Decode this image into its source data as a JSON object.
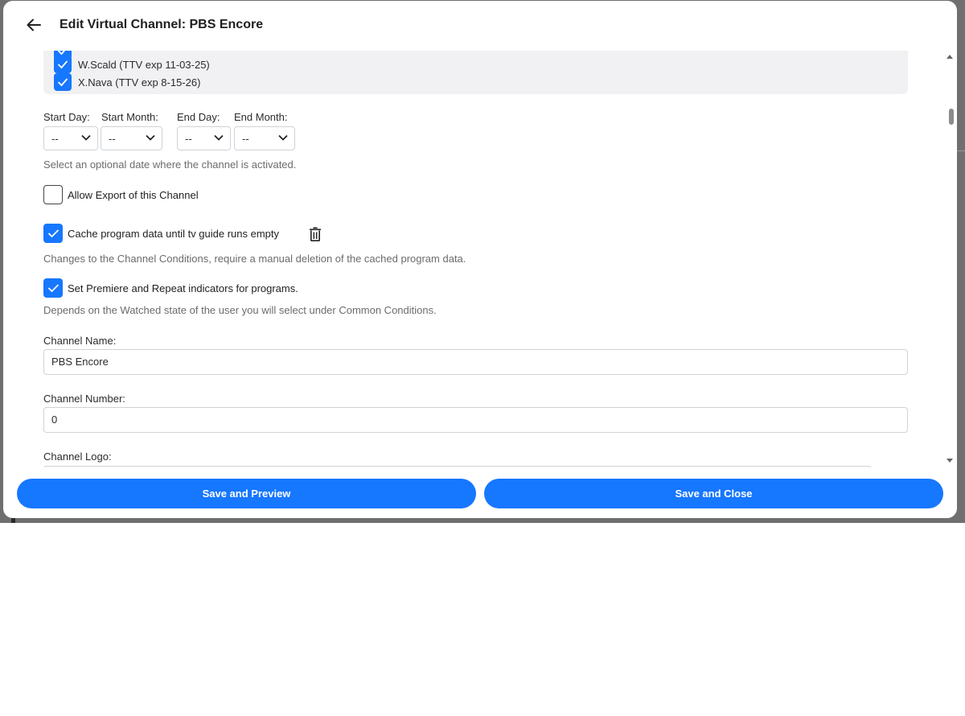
{
  "header": {
    "back_icon": "arrow-left-icon",
    "title": "Edit Virtual Channel: PBS Encore"
  },
  "users": [
    {
      "label": "W.Scald (TTV exp 11-03-25)",
      "checked": true
    },
    {
      "label": "X.Nava (TTV exp 8-15-26)",
      "checked": true
    }
  ],
  "dates": {
    "start_day_label": "Start Day:",
    "start_month_label": "Start Month:",
    "end_day_label": "End Day:",
    "end_month_label": "End Month:",
    "start_day_value": "--",
    "start_month_value": "--",
    "end_day_value": "--",
    "end_month_value": "--",
    "helper": "Select an optional date where the channel is activated."
  },
  "options": {
    "allow_export_label": "Allow Export of this Channel",
    "allow_export_checked": false,
    "cache_label": "Cache program data until tv guide runs empty",
    "cache_checked": true,
    "cache_helper": "Changes to the Channel Conditions, require a manual deletion of the cached program data.",
    "premiere_label": "Set Premiere and Repeat indicators for programs.",
    "premiere_checked": true,
    "premiere_helper": "Depends on the Watched state of the user you will select under Common Conditions."
  },
  "fields": {
    "channel_name_label": "Channel Name:",
    "channel_name_value": "PBS Encore",
    "channel_number_label": "Channel Number:",
    "channel_number_value": "0",
    "channel_logo_label": "Channel Logo:"
  },
  "footer": {
    "save_preview_label": "Save and Preview",
    "save_close_label": "Save and Close"
  },
  "colors": {
    "accent": "#1677ff",
    "backdrop": "#6f6f6f",
    "panel": "#f1f1f3"
  }
}
